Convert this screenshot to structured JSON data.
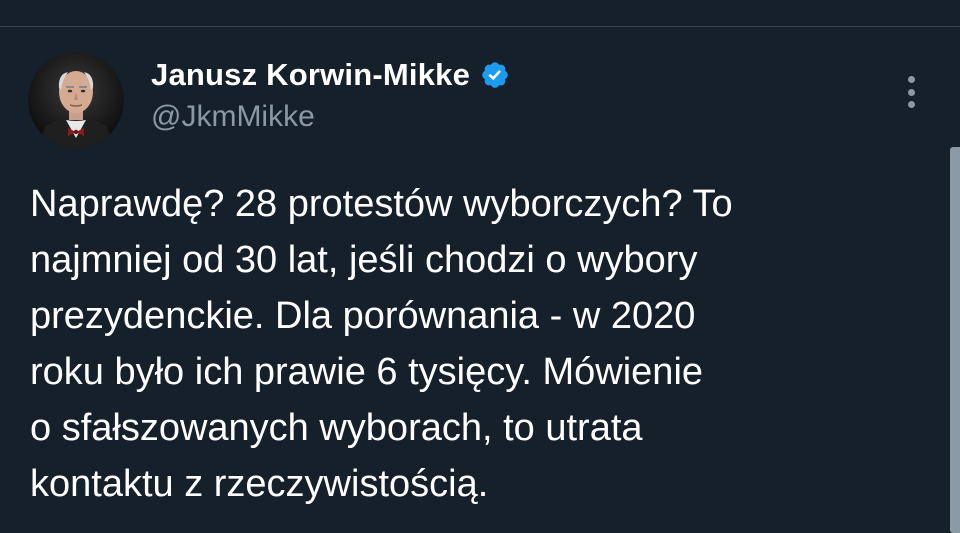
{
  "tweet": {
    "author": {
      "name": "Janusz Korwin-Mikke",
      "handle": "@JkmMikke",
      "verified": true,
      "avatar_icon": "avatar-photo"
    },
    "more_icon": "more-vertical-icon",
    "text_lines": [
      "Naprawdę? 28 protestów wyborczych? To",
      "najmniej od 30 lat, jeśli chodzi o wybory",
      "prezydenckie. Dla porównania - w 2020",
      "roku było ich prawie 6 tysięcy. Mówienie",
      "o sfałszowanych wyborach, to utrata",
      "kontaktu z rzeczywistością."
    ]
  },
  "colors": {
    "background": "#15202b",
    "text_primary": "#ffffff",
    "text_secondary": "#8b98a5",
    "verified_badge": "#1d9bf0",
    "divider": "#38444d"
  }
}
